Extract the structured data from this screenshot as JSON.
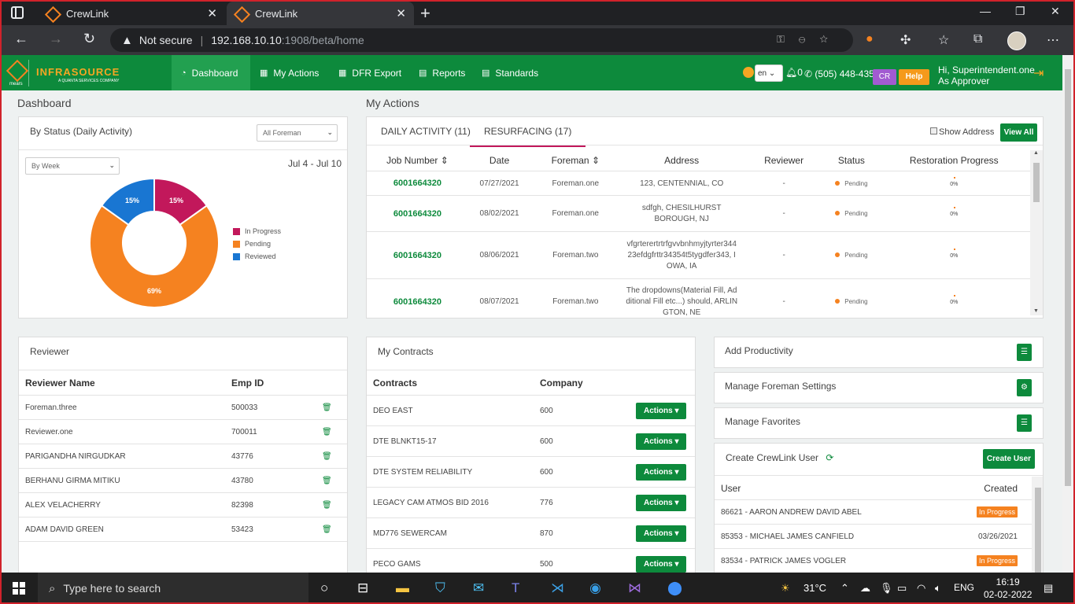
{
  "browser": {
    "tabs": [
      {
        "title": "CrewLink"
      },
      {
        "title": "CrewLink"
      }
    ],
    "security_label": "Not secure",
    "url_host": "192.168.10.10",
    "url_path": ":1908/beta/home"
  },
  "app": {
    "logo_name": "INFRASOURCE",
    "logo_sub": "A QUANTA SERVICES COMPANY",
    "logo_small": "mears",
    "nav": [
      {
        "label": "Dashboard",
        "icon": "dashboard-icon"
      },
      {
        "label": "My Actions",
        "icon": "calendar-icon"
      },
      {
        "label": "DFR Export",
        "icon": "calendar-icon"
      },
      {
        "label": "Reports",
        "icon": "document-icon"
      },
      {
        "label": "Standards",
        "icon": "document-icon"
      }
    ],
    "lang": "en",
    "notif_count": "0",
    "phone": "(505) 448-4357",
    "cr_label": "CR",
    "help_label": "Help",
    "greeting": "Hi, Superintendent.one",
    "role": "As Approver"
  },
  "dashboard": {
    "title": "Dashboard",
    "status_card": {
      "title": "By Status (Daily Activity)",
      "foreman_select": "All Foreman",
      "period_select": "By Week",
      "date_range": "Jul 4 - Jul 10",
      "legend": [
        {
          "label": "In Progress",
          "color": "#c2185b"
        },
        {
          "label": "Pending",
          "color": "#f58220"
        },
        {
          "label": "Reviewed",
          "color": "#1976d2"
        }
      ]
    }
  },
  "chart_data": {
    "type": "pie",
    "title": "By Status (Daily Activity)",
    "categories": [
      "In Progress",
      "Pending",
      "Reviewed"
    ],
    "values": [
      15,
      69,
      15
    ],
    "labels": [
      "15%",
      "69%",
      "15%"
    ],
    "colors": [
      "#c2185b",
      "#f58220",
      "#1976d2"
    ],
    "donut": true,
    "legend": "right"
  },
  "my_actions": {
    "title": "My Actions",
    "tabs": [
      "DAILY ACTIVITY (11)",
      "RESURFACING (17)"
    ],
    "show_address": "Show Address",
    "view_all": "View All",
    "columns": [
      "Job Number",
      "Date",
      "Foreman",
      "Address",
      "Reviewer",
      "Status",
      "Restoration Progress"
    ],
    "rows": [
      {
        "job": "6001664320",
        "date": "07/27/2021",
        "foreman": "Foreman.one",
        "address": "123, CENTENNIAL, CO",
        "reviewer": "-",
        "status": "Pending",
        "progress": "0%"
      },
      {
        "job": "6001664320",
        "date": "08/02/2021",
        "foreman": "Foreman.one",
        "address": "sdfgh, CHESILHURST BOROUGH, NJ",
        "reviewer": "-",
        "status": "Pending",
        "progress": "0%"
      },
      {
        "job": "6001664320",
        "date": "08/06/2021",
        "foreman": "Foreman.two",
        "address": "vfgrterertrtrfgvvbnhmyjtyrter34423efdgfrttr34354t5tygdfer343, IOWA, IA",
        "reviewer": "-",
        "status": "Pending",
        "progress": "0%"
      },
      {
        "job": "6001664320",
        "date": "08/07/2021",
        "foreman": "Foreman.two",
        "address": "The dropdowns(Material Fill, Additional Fill etc...) should, ARLINGTON, NE",
        "reviewer": "-",
        "status": "Pending",
        "progress": "0%"
      }
    ]
  },
  "reviewer": {
    "title": "Reviewer",
    "columns": [
      "Reviewer Name",
      "Emp ID"
    ],
    "rows": [
      {
        "name": "Foreman.three",
        "id": "500033"
      },
      {
        "name": "Reviewer.one",
        "id": "700011"
      },
      {
        "name": "PARIGANDHA NIRGUDKAR",
        "id": "43776"
      },
      {
        "name": "BERHANU GIRMA MITIKU",
        "id": "43780"
      },
      {
        "name": "ALEX VELACHERRY",
        "id": "82398"
      },
      {
        "name": "ADAM DAVID GREEN",
        "id": "53423"
      }
    ]
  },
  "contracts": {
    "title": "My Contracts",
    "columns": [
      "Contracts",
      "Company"
    ],
    "action_label": "Actions",
    "rows": [
      {
        "name": "DEO EAST",
        "company": "600"
      },
      {
        "name": "DTE BLNKT15-17",
        "company": "600"
      },
      {
        "name": "DTE SYSTEM RELIABILITY",
        "company": "600"
      },
      {
        "name": "LEGACY CAM ATMOS BID 2016",
        "company": "776"
      },
      {
        "name": "MD776 SEWERCAM",
        "company": "870"
      },
      {
        "name": "PECO GAMS",
        "company": "500"
      }
    ]
  },
  "quick": {
    "add_productivity": "Add Productivity",
    "manage_foreman": "Manage Foreman Settings",
    "manage_favorites": "Manage Favorites",
    "create_user": "Create CrewLink User",
    "create_user_btn": "Create User",
    "columns": [
      "User",
      "Created"
    ],
    "users": [
      {
        "user": "86621 - AARON ANDREW DAVID ABEL",
        "created": "In Progress",
        "badge": true
      },
      {
        "user": "85353 - MICHAEL JAMES CANFIELD",
        "created": "03/26/2021",
        "badge": false
      },
      {
        "user": "83534 - PATRICK JAMES VOGLER",
        "created": "In Progress",
        "badge": true
      }
    ]
  },
  "taskbar": {
    "search_placeholder": "Type here to search",
    "weather": "31°C",
    "lang": "ENG",
    "time": "16:19",
    "date": "02-02-2022"
  }
}
